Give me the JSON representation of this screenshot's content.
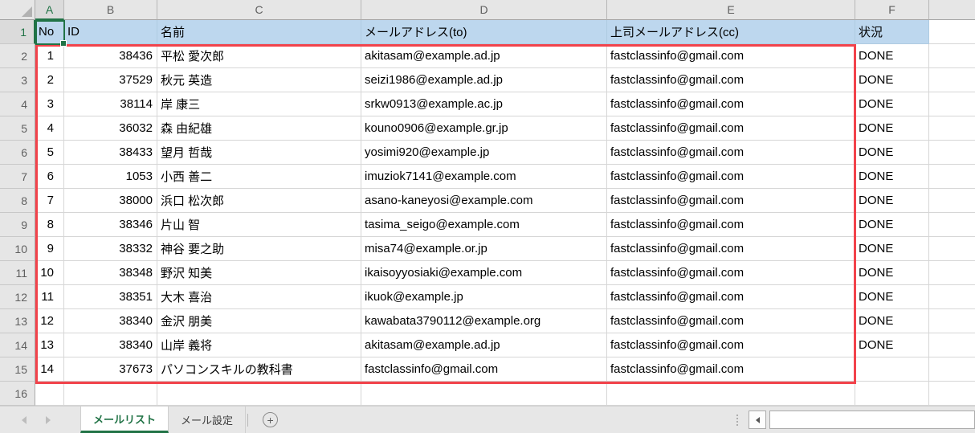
{
  "selection": {
    "active_cell": "A1",
    "active_column": "A",
    "active_row": "1"
  },
  "column_letters": [
    "A",
    "B",
    "C",
    "D",
    "E",
    "F"
  ],
  "row_numbers": [
    "1",
    "2",
    "3",
    "4",
    "5",
    "6",
    "7",
    "8",
    "9",
    "10",
    "11",
    "12",
    "13",
    "14",
    "15",
    "16"
  ],
  "header_row": {
    "no": "No",
    "id": "ID",
    "name": "名前",
    "email_to": "メールアドレス(to)",
    "email_cc": "上司メールアドレス(cc)",
    "status": "状況"
  },
  "rows": [
    {
      "no": "1",
      "id": "38436",
      "name": "平松 愛次郎",
      "email_to": "akitasam@example.ad.jp",
      "email_cc": "fastclassinfo@gmail.com",
      "status": "DONE"
    },
    {
      "no": "2",
      "id": "37529",
      "name": "秋元 英造",
      "email_to": "seizi1986@example.ad.jp",
      "email_cc": "fastclassinfo@gmail.com",
      "status": "DONE"
    },
    {
      "no": "3",
      "id": "38114",
      "name": "岸 康三",
      "email_to": "srkw0913@example.ac.jp",
      "email_cc": "fastclassinfo@gmail.com",
      "status": "DONE"
    },
    {
      "no": "4",
      "id": "36032",
      "name": "森 由紀雄",
      "email_to": "kouno0906@example.gr.jp",
      "email_cc": "fastclassinfo@gmail.com",
      "status": "DONE"
    },
    {
      "no": "5",
      "id": "38433",
      "name": "望月 哲哉",
      "email_to": "yosimi920@example.jp",
      "email_cc": "fastclassinfo@gmail.com",
      "status": "DONE"
    },
    {
      "no": "6",
      "id": "1053",
      "name": "小西 善二",
      "email_to": "imuziok7141@example.com",
      "email_cc": "fastclassinfo@gmail.com",
      "status": "DONE"
    },
    {
      "no": "7",
      "id": "38000",
      "name": "浜口 松次郎",
      "email_to": "asano-kaneyosi@example.com",
      "email_cc": "fastclassinfo@gmail.com",
      "status": "DONE"
    },
    {
      "no": "8",
      "id": "38346",
      "name": "片山 智",
      "email_to": "tasima_seigo@example.com",
      "email_cc": "fastclassinfo@gmail.com",
      "status": "DONE"
    },
    {
      "no": "9",
      "id": "38332",
      "name": "神谷 要之助",
      "email_to": "misa74@example.or.jp",
      "email_cc": "fastclassinfo@gmail.com",
      "status": "DONE"
    },
    {
      "no": "10",
      "id": "38348",
      "name": "野沢 知美",
      "email_to": "ikaisoyyosiaki@example.com",
      "email_cc": "fastclassinfo@gmail.com",
      "status": "DONE"
    },
    {
      "no": "11",
      "id": "38351",
      "name": "大木 喜治",
      "email_to": "ikuok@example.jp",
      "email_cc": "fastclassinfo@gmail.com",
      "status": "DONE"
    },
    {
      "no": "12",
      "id": "38340",
      "name": "金沢 朋美",
      "email_to": "kawabata3790112@example.org",
      "email_cc": "fastclassinfo@gmail.com",
      "status": "DONE"
    },
    {
      "no": "13",
      "id": "38340",
      "name": "山岸 義将",
      "email_to": "akitasam@example.ad.jp",
      "email_cc": "fastclassinfo@gmail.com",
      "status": "DONE"
    },
    {
      "no": "14",
      "id": "37673",
      "name": "パソコンスキルの教科書",
      "email_to": "fastclassinfo@gmail.com",
      "email_cc": "fastclassinfo@gmail.com",
      "status": ""
    }
  ],
  "sheet_tabs": {
    "tabs": [
      {
        "label": "メールリスト",
        "active": true
      },
      {
        "label": "メール設定",
        "active": false
      }
    ],
    "add_sheet": "+"
  },
  "colors": {
    "header_fill": "#BDD7EE",
    "selection_green": "#217346",
    "range_border": "#F2434B",
    "tab_active_green": "#217346",
    "grid_line": "#D6D6D6",
    "header_strip": "#E6E6E6"
  }
}
